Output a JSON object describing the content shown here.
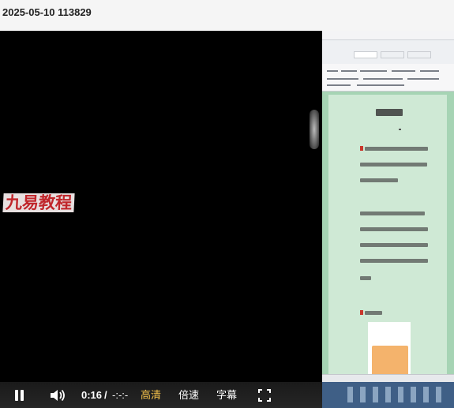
{
  "page": {
    "title": "2025-05-10 113829"
  },
  "video": {
    "watermark": "九易教程",
    "document_title": "",
    "accent_colors": {
      "watermark": "#c0262b",
      "hd": "#f5c24b",
      "doc_bg": "#cfe9d5"
    }
  },
  "controls": {
    "play_state_icon": "pause-icon",
    "volume_icon": "volume-icon",
    "current_time": "0:16",
    "separator": "/",
    "duration": "-:-:-",
    "quality_label": "高清",
    "speed_label": "倍速",
    "subtitle_label": "字幕",
    "fullscreen_icon": "fullscreen-icon"
  }
}
